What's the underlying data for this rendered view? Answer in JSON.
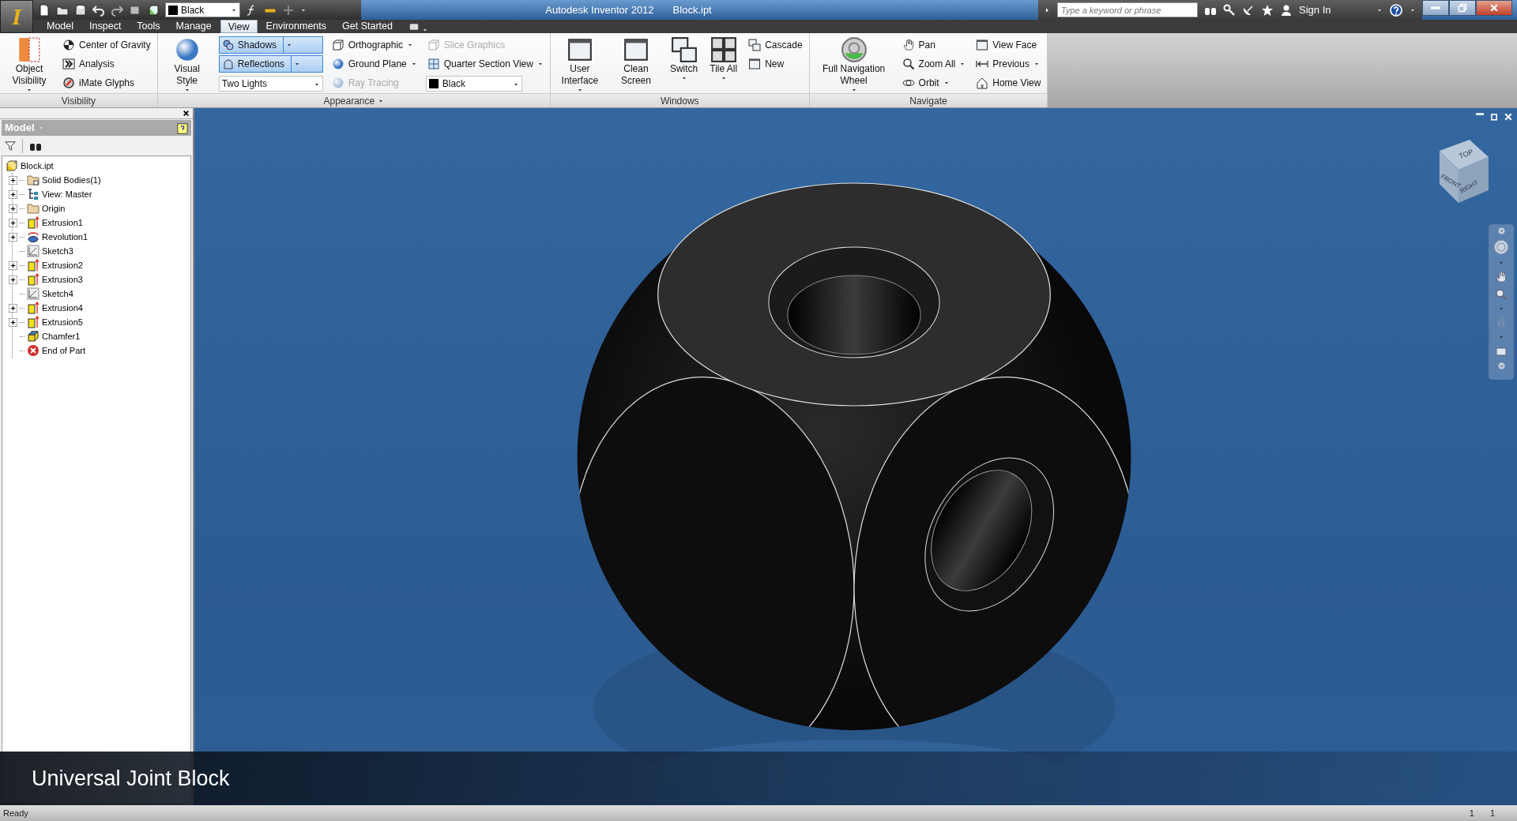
{
  "app_button": {
    "glyph": "I"
  },
  "quick_access": {
    "style_combo": "Black"
  },
  "title": {
    "app": "Autodesk Inventor 2012",
    "document": "Block.ipt"
  },
  "info_center": {
    "search": {
      "placeholder": "Type a keyword or phrase"
    },
    "sign_in": "Sign In"
  },
  "tabs": [
    {
      "label": "Model",
      "selected": false
    },
    {
      "label": "Inspect",
      "selected": false
    },
    {
      "label": "Tools",
      "selected": false
    },
    {
      "label": "Manage",
      "selected": false
    },
    {
      "label": "View",
      "selected": true
    },
    {
      "label": "Environments",
      "selected": false
    },
    {
      "label": "Get Started",
      "selected": false
    }
  ],
  "ribbon": {
    "panels": [
      {
        "title": "Visibility",
        "has_menu": false,
        "columns": [
          [
            {
              "kind": "large",
              "label": "Object Visibility",
              "has_menu": true
            }
          ],
          [
            {
              "kind": "small",
              "label": "Center of Gravity",
              "has_menu": false,
              "disabled": false
            },
            {
              "kind": "small",
              "label": "Analysis",
              "has_menu": false,
              "disabled": false
            },
            {
              "kind": "small",
              "label": "iMate Glyphs",
              "has_menu": false,
              "disabled": false
            }
          ]
        ]
      },
      {
        "title": "Appearance",
        "has_menu": true,
        "columns": [
          [
            {
              "kind": "large",
              "label": "Visual Style",
              "has_menu": true
            }
          ],
          [
            {
              "kind": "toggle",
              "label": "Shadows",
              "selected": true
            },
            {
              "kind": "toggle",
              "label": "Reflections",
              "selected": true
            },
            {
              "kind": "combo",
              "label": "Two Lights"
            }
          ],
          [
            {
              "kind": "small",
              "label": "Orthographic",
              "has_menu": true,
              "disabled": false
            },
            {
              "kind": "small",
              "label": "Ground Plane",
              "has_menu": true,
              "disabled": false
            },
            {
              "kind": "small",
              "label": "Ray Tracing",
              "has_menu": false,
              "disabled": true
            }
          ],
          [
            {
              "kind": "small",
              "label": "Slice Graphics",
              "has_menu": false,
              "disabled": true
            },
            {
              "kind": "small",
              "label": "Quarter Section View",
              "has_menu": true,
              "disabled": false
            },
            {
              "kind": "combo",
              "label": "Black"
            }
          ]
        ]
      },
      {
        "title": "Windows",
        "has_menu": false,
        "columns": [
          [
            {
              "kind": "large",
              "label": "User Interface",
              "has_menu": true
            }
          ],
          [
            {
              "kind": "large",
              "label": "Clean Screen",
              "has_menu": false
            }
          ],
          [
            {
              "kind": "large",
              "label": "Switch",
              "has_menu": true
            }
          ],
          [
            {
              "kind": "large",
              "label": "Tile All",
              "has_menu": true
            }
          ],
          [
            {
              "kind": "small",
              "label": "Cascade",
              "has_menu": false,
              "disabled": false
            },
            {
              "kind": "small",
              "label": "New",
              "has_menu": false,
              "disabled": false
            }
          ]
        ]
      },
      {
        "title": "Navigate",
        "has_menu": false,
        "columns": [
          [
            {
              "kind": "large",
              "label": "Full Navigation Wheel",
              "has_menu": true
            }
          ],
          [
            {
              "kind": "small",
              "label": "Pan",
              "has_menu": false,
              "disabled": false
            },
            {
              "kind": "small",
              "label": "Zoom All",
              "has_menu": true,
              "disabled": false
            },
            {
              "kind": "small",
              "label": "Orbit",
              "has_menu": true,
              "disabled": false
            }
          ],
          [
            {
              "kind": "small",
              "label": "View Face",
              "has_menu": false,
              "disabled": false
            },
            {
              "kind": "small",
              "label": "Previous",
              "has_menu": true,
              "disabled": false
            },
            {
              "kind": "small",
              "label": "Home View",
              "has_menu": false,
              "disabled": false
            }
          ]
        ]
      }
    ]
  },
  "browser": {
    "title": "Model",
    "tree": {
      "label": "Block.ipt",
      "kind": "part",
      "children": [
        {
          "label": "Solid Bodies(1)",
          "kind": "bodies",
          "expandable": true
        },
        {
          "label": "View: Master",
          "kind": "view",
          "expandable": true
        },
        {
          "label": "Origin",
          "kind": "folder",
          "expandable": true
        },
        {
          "label": "Extrusion1",
          "kind": "extrusion",
          "expandable": true
        },
        {
          "label": "Revolution1",
          "kind": "revolution",
          "expandable": true
        },
        {
          "label": "Sketch3",
          "kind": "sketch",
          "expandable": false
        },
        {
          "label": "Extrusion2",
          "kind": "extrusion",
          "expandable": true
        },
        {
          "label": "Extrusion3",
          "kind": "extrusion",
          "expandable": true
        },
        {
          "label": "Sketch4",
          "kind": "sketch",
          "expandable": false
        },
        {
          "label": "Extrusion4",
          "kind": "extrusion",
          "expandable": true
        },
        {
          "label": "Extrusion5",
          "kind": "extrusion",
          "expandable": true
        },
        {
          "label": "Chamfer1",
          "kind": "chamfer",
          "expandable": false
        },
        {
          "label": "End of Part",
          "kind": "end",
          "expandable": false
        }
      ]
    }
  },
  "viewport": {
    "view_cube": {
      "top": "TOP",
      "front": "FRONT",
      "right": "RIGHT"
    }
  },
  "caption": "Universal Joint Block",
  "status_bar": {
    "message": "Ready",
    "fields": [
      "1",
      "1"
    ]
  }
}
